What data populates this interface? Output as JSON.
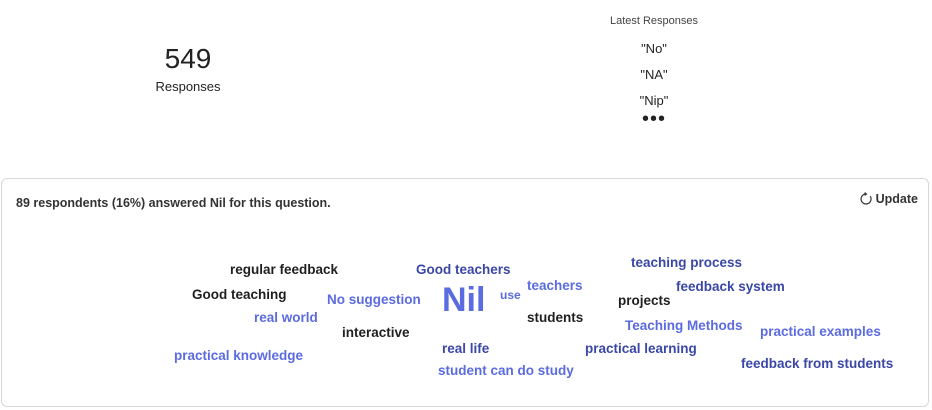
{
  "summary": {
    "count": "549",
    "count_label": "Responses",
    "latest_title": "Latest Responses",
    "latest": [
      "\"No\"",
      "\"NA\"",
      "\"Nip\""
    ],
    "more": "•••"
  },
  "card": {
    "nil_note": "89 respondents (16%) answered Nil for this question.",
    "update_label": "Update",
    "update_icon": "refresh-icon"
  },
  "wordcloud": [
    {
      "text": "regular feedback"
    },
    {
      "text": "Good teachers"
    },
    {
      "text": "teaching process"
    },
    {
      "text": "Good teaching"
    },
    {
      "text": "No suggestion"
    },
    {
      "text": "Nil"
    },
    {
      "text": "use"
    },
    {
      "text": "teachers"
    },
    {
      "text": "feedback system"
    },
    {
      "text": "projects"
    },
    {
      "text": "real world"
    },
    {
      "text": "students"
    },
    {
      "text": "interactive"
    },
    {
      "text": "Teaching Methods"
    },
    {
      "text": "practical examples"
    },
    {
      "text": "practical knowledge"
    },
    {
      "text": "real life"
    },
    {
      "text": "practical learning"
    },
    {
      "text": "feedback from students"
    },
    {
      "text": "student can do study"
    }
  ],
  "colors": {
    "dark": "#1f1f1f",
    "navy": "#3a47a7",
    "blue": "#5b6be0",
    "border": "#d8d8d8"
  }
}
